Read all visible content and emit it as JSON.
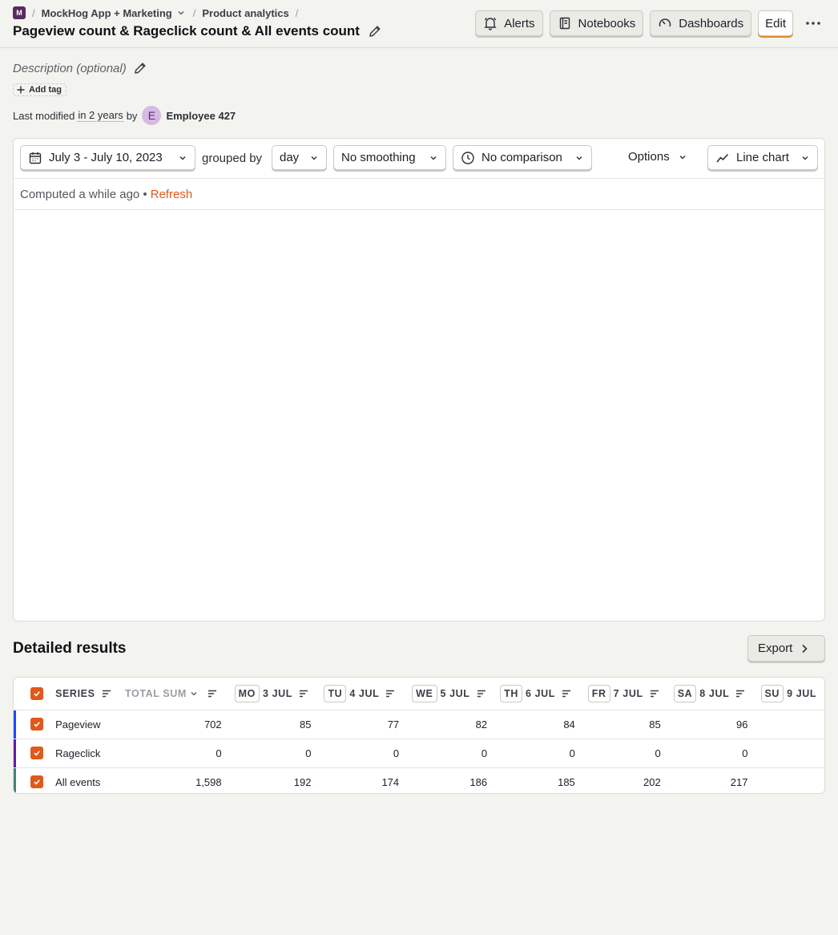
{
  "header": {
    "project_logo_letter": "M",
    "project_name": "MockHog App + Marketing",
    "section": "Product analytics",
    "title": "Pageview count & Rageclick count & All events count",
    "actions": {
      "alerts": "Alerts",
      "notebooks": "Notebooks",
      "dashboards": "Dashboards",
      "edit": "Edit"
    }
  },
  "meta": {
    "description_placeholder": "Description (optional)",
    "add_tag": "Add tag",
    "last_modified_prefix": "Last modified",
    "last_modified_when": "in 2 years",
    "by": "by",
    "avatar_letter": "E",
    "author": "Employee 427"
  },
  "toolbar": {
    "date_range": "July 3 - July 10, 2023",
    "grouped_by": "grouped by",
    "interval": "day",
    "smoothing": "No smoothing",
    "comparison": "No comparison",
    "options": "Options",
    "chart_type": "Line chart"
  },
  "status": {
    "computed": "Computed a while ago •",
    "refresh": "Refresh"
  },
  "results": {
    "title": "Detailed results",
    "export": "Export",
    "columns": {
      "series": "SERIES",
      "total": "TOTAL SUM",
      "days": [
        {
          "badge": "MO",
          "date": "3 JUL"
        },
        {
          "badge": "TU",
          "date": "4 JUL"
        },
        {
          "badge": "WE",
          "date": "5 JUL"
        },
        {
          "badge": "TH",
          "date": "6 JUL"
        },
        {
          "badge": "FR",
          "date": "7 JUL"
        },
        {
          "badge": "SA",
          "date": "8 JUL"
        },
        {
          "badge": "SU",
          "date": "9 JUL"
        }
      ]
    },
    "rows": [
      {
        "name": "Pageview",
        "color": "#1d4aff",
        "total": "702",
        "days": [
          "85",
          "77",
          "82",
          "84",
          "85",
          "96",
          ""
        ]
      },
      {
        "name": "Rageclick",
        "color": "#621da6",
        "total": "0",
        "days": [
          "0",
          "0",
          "0",
          "0",
          "0",
          "0",
          ""
        ]
      },
      {
        "name": "All events",
        "color": "#42827e",
        "total": "1,598",
        "days": [
          "192",
          "174",
          "186",
          "185",
          "202",
          "217",
          ""
        ]
      }
    ]
  },
  "colors": {
    "accent": "#e0591b",
    "edit_underline": "#e28a28",
    "project_logo": "#5a2a60"
  }
}
